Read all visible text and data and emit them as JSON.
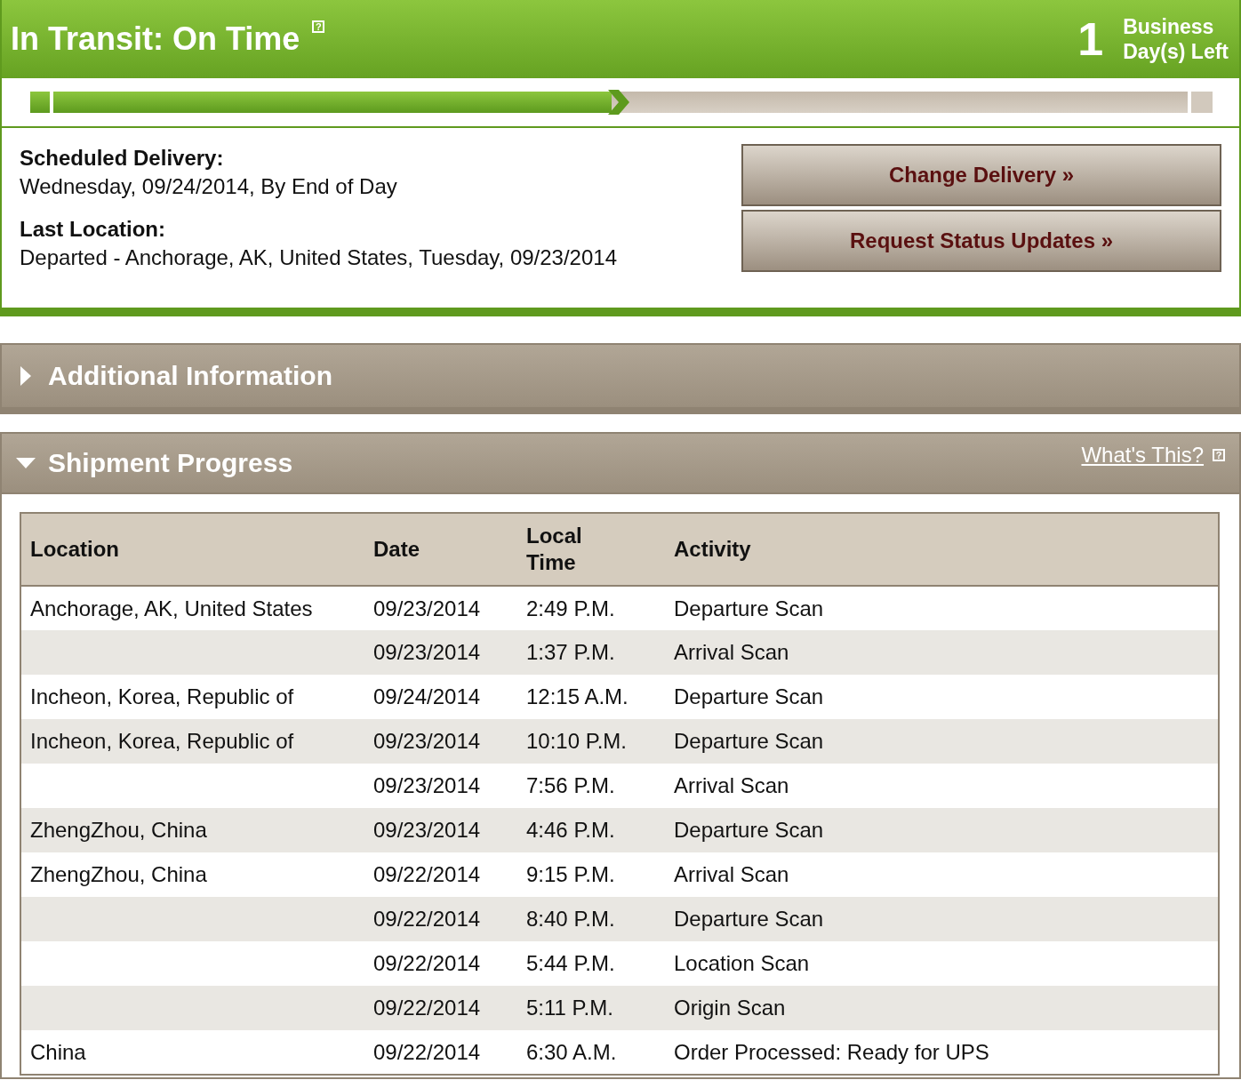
{
  "status": {
    "title": "In Transit: On Time",
    "help_glyph": "?",
    "days_count": "1",
    "days_label_1": "Business",
    "days_label_2": "Day(s) Left"
  },
  "progress": {
    "level": 0.5
  },
  "delivery": {
    "scheduled_label": "Scheduled Delivery:",
    "scheduled_value": "Wednesday, 09/24/2014, By End of Day",
    "location_label": "Last Location:",
    "location_value": "Departed - Anchorage, AK, United States, Tuesday, 09/23/2014"
  },
  "buttons": [
    "Change Delivery »",
    "Request Status Updates »"
  ],
  "sections": [
    {
      "title": "Additional Information",
      "expanded": false
    },
    {
      "title": "Shipment Progress",
      "expanded": true,
      "link": "What's This?",
      "help_glyph": "?"
    }
  ],
  "table": {
    "columns": [
      "Location",
      "Date",
      "Local Time",
      "Activity"
    ],
    "rows": [
      [
        "Anchorage, AK, United States",
        "09/23/2014",
        "2:49 P.M.",
        "Departure Scan"
      ],
      [
        "",
        "09/23/2014",
        "1:37 P.M.",
        "Arrival Scan"
      ],
      [
        "Incheon, Korea, Republic of",
        "09/24/2014",
        "12:15 A.M.",
        "Departure Scan"
      ],
      [
        "Incheon, Korea, Republic of",
        "09/23/2014",
        "10:10 P.M.",
        "Departure Scan"
      ],
      [
        "",
        "09/23/2014",
        "7:56 P.M.",
        "Arrival Scan"
      ],
      [
        "ZhengZhou, China",
        "09/23/2014",
        "4:46 P.M.",
        "Departure Scan"
      ],
      [
        "ZhengZhou, China",
        "09/22/2014",
        "9:15 P.M.",
        "Arrival Scan"
      ],
      [
        "",
        "09/22/2014",
        "8:40 P.M.",
        "Departure Scan"
      ],
      [
        "",
        "09/22/2014",
        "5:44 P.M.",
        "Location Scan"
      ],
      [
        "",
        "09/22/2014",
        "5:11 P.M.",
        "Origin Scan"
      ],
      [
        "China",
        "09/22/2014",
        "6:30 A.M.",
        "Order Processed: Ready for UPS"
      ]
    ]
  }
}
